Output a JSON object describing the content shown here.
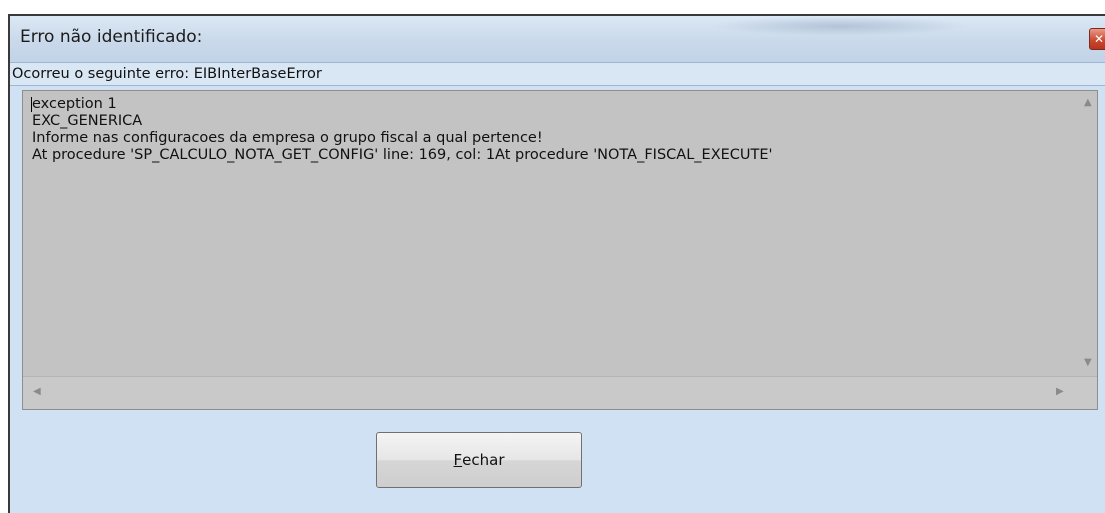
{
  "window": {
    "title": "Erro não identificado:",
    "close_glyph": "✕"
  },
  "error": {
    "label": "Ocorreu o seguinte erro: EIBInterBaseError",
    "lines": [
      "exception 1",
      "EXC_GENERICA",
      "Informe nas configuracoes da empresa o grupo fiscal a qual pertence!",
      "At procedure 'SP_CALCULO_NOTA_GET_CONFIG' line: 169, col: 1At procedure 'NOTA_FISCAL_EXECUTE'"
    ]
  },
  "button": {
    "accel": "F",
    "rest": "echar"
  },
  "icons": {
    "scroll_up": "▲",
    "scroll_down": "▼",
    "scroll_left": "◀",
    "scroll_right": "▶"
  }
}
